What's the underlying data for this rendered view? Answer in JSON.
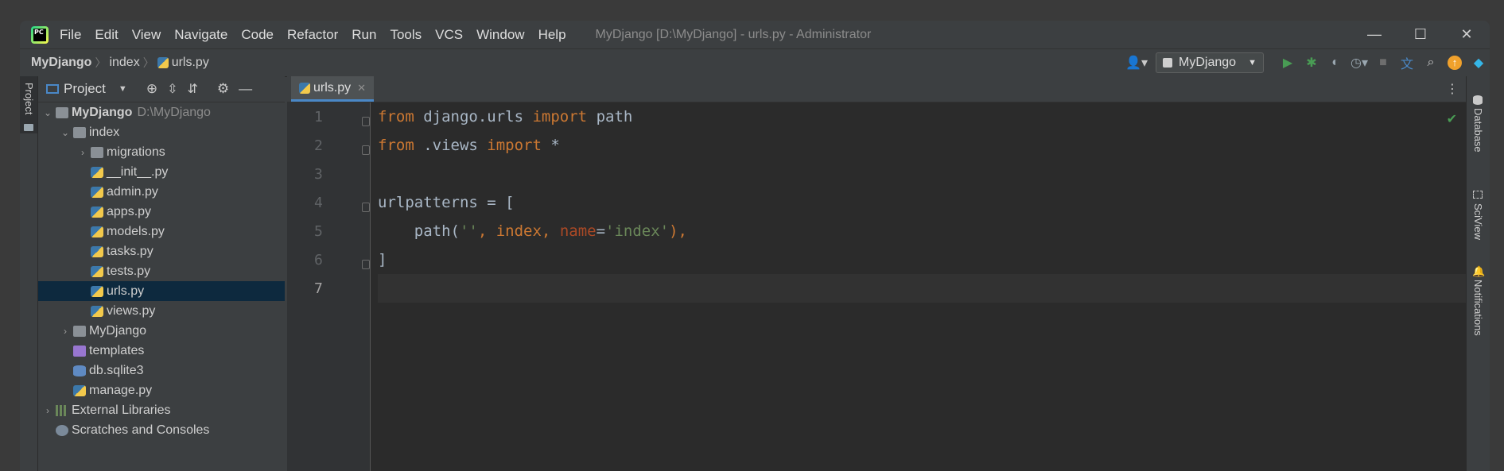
{
  "titlebar": {
    "menu": [
      "File",
      "Edit",
      "View",
      "Navigate",
      "Code",
      "Refactor",
      "Run",
      "Tools",
      "VCS",
      "Window",
      "Help"
    ],
    "window_title": "MyDjango [D:\\MyDjango] - urls.py - Administrator",
    "minimize": "—",
    "maximize": "☐",
    "close": "✕"
  },
  "navbar": {
    "crumbs": [
      "MyDjango",
      "index",
      "urls.py"
    ],
    "run_config": "MyDjango"
  },
  "left_stripe": {
    "project_tab": "Project"
  },
  "project_panel": {
    "title": "Project",
    "tree": [
      {
        "label": "MyDjango",
        "extra": "D:\\MyDjango"
      },
      {
        "label": "index"
      },
      {
        "label": "migrations"
      },
      {
        "label": "__init__.py"
      },
      {
        "label": "admin.py"
      },
      {
        "label": "apps.py"
      },
      {
        "label": "models.py"
      },
      {
        "label": "tasks.py"
      },
      {
        "label": "tests.py"
      },
      {
        "label": "urls.py"
      },
      {
        "label": "views.py"
      },
      {
        "label": "MyDjango"
      },
      {
        "label": "templates"
      },
      {
        "label": "db.sqlite3"
      },
      {
        "label": "manage.py"
      },
      {
        "label": "External Libraries"
      },
      {
        "label": "Scratches and Consoles"
      }
    ]
  },
  "editor": {
    "tab_label": "urls.py",
    "line_numbers": [
      "1",
      "2",
      "3",
      "4",
      "5",
      "6",
      "7"
    ],
    "code": {
      "l1": [
        "from",
        " django.urls ",
        "import",
        " path"
      ],
      "l2": [
        "from",
        " .views ",
        "import",
        " *"
      ],
      "l4": "urlpatterns = [",
      "l5": [
        "    path(",
        "''",
        ", index",
        ", ",
        "name",
        "=",
        "'index'",
        "),"
      ],
      "l6": "]"
    }
  },
  "right_stripe": {
    "tabs": [
      "Database",
      "SciView",
      "Notifications"
    ]
  }
}
